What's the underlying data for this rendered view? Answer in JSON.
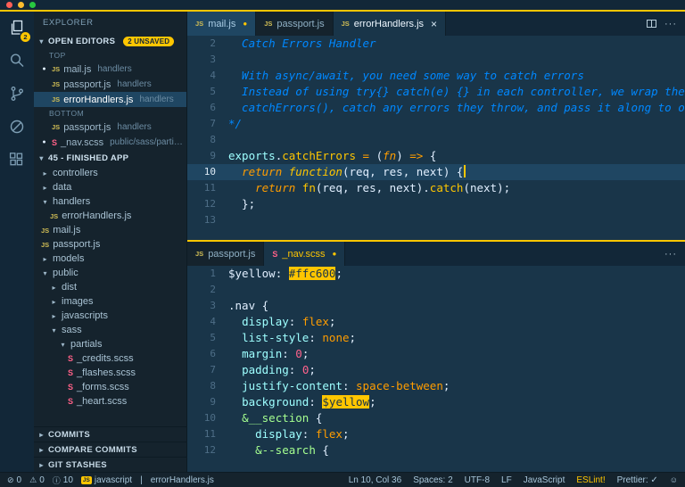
{
  "window": {
    "buttons": [
      "close",
      "minimize",
      "zoom"
    ],
    "accent_color": "#ffc600"
  },
  "activity_bar": {
    "items": [
      {
        "name": "explorer",
        "icon": "files-icon",
        "active": true,
        "badge": "2"
      },
      {
        "name": "search",
        "icon": "search-icon",
        "active": false
      },
      {
        "name": "source-control",
        "icon": "git-branch-icon",
        "active": false
      },
      {
        "name": "debug",
        "icon": "debug-icon",
        "active": false
      },
      {
        "name": "extensions",
        "icon": "extensions-icon",
        "active": false
      }
    ]
  },
  "sidebar": {
    "title": "EXPLORER",
    "open_editors": {
      "label": "OPEN EDITORS",
      "badge": "2 UNSAVED",
      "groups": [
        {
          "label": "TOP",
          "items": [
            {
              "icon": "js",
              "name": "mail.js",
              "detail": "handlers",
              "modified": true,
              "selected": false
            },
            {
              "icon": "js",
              "name": "passport.js",
              "detail": "handlers",
              "modified": false,
              "selected": false
            },
            {
              "icon": "js",
              "name": "errorHandlers.js",
              "detail": "handlers",
              "modified": false,
              "selected": true
            }
          ]
        },
        {
          "label": "BOTTOM",
          "items": [
            {
              "icon": "js",
              "name": "passport.js",
              "detail": "handlers",
              "modified": false,
              "selected": false
            },
            {
              "icon": "scss",
              "name": "_nav.scss",
              "detail": "public/sass/partials",
              "modified": true,
              "selected": false
            }
          ]
        }
      ]
    },
    "tree": {
      "label": "45 - FINISHED APP",
      "items": [
        {
          "indent": 0,
          "kind": "folder",
          "expanded": false,
          "name": "controllers"
        },
        {
          "indent": 0,
          "kind": "folder",
          "expanded": false,
          "name": "data"
        },
        {
          "indent": 0,
          "kind": "folder",
          "expanded": true,
          "name": "handlers"
        },
        {
          "indent": 1,
          "kind": "js",
          "name": "errorHandlers.js"
        },
        {
          "indent": 0,
          "kind": "js",
          "name": "mail.js"
        },
        {
          "indent": 0,
          "kind": "js",
          "name": "passport.js"
        },
        {
          "indent": 0,
          "kind": "folder",
          "expanded": false,
          "name": "models"
        },
        {
          "indent": 0,
          "kind": "folder",
          "expanded": true,
          "name": "public"
        },
        {
          "indent": 1,
          "kind": "folder",
          "expanded": false,
          "name": "dist"
        },
        {
          "indent": 1,
          "kind": "folder",
          "expanded": false,
          "name": "images"
        },
        {
          "indent": 1,
          "kind": "folder",
          "expanded": false,
          "name": "javascripts"
        },
        {
          "indent": 1,
          "kind": "folder",
          "expanded": true,
          "name": "sass"
        },
        {
          "indent": 2,
          "kind": "folder",
          "expanded": true,
          "name": "partials"
        },
        {
          "indent": 3,
          "kind": "scss",
          "name": "_credits.scss"
        },
        {
          "indent": 3,
          "kind": "scss",
          "name": "_flashes.scss"
        },
        {
          "indent": 3,
          "kind": "scss",
          "name": "_forms.scss"
        },
        {
          "indent": 3,
          "kind": "scss",
          "name": "_heart.scss"
        }
      ]
    },
    "bottom_sections": [
      "COMMITS",
      "COMPARE COMMITS",
      "GIT STASHES"
    ]
  },
  "editor_groups": [
    {
      "name": "top",
      "tabs": [
        {
          "label": "mail.js",
          "icon": "js",
          "state": "highlight",
          "modified": true,
          "close": false
        },
        {
          "label": "passport.js",
          "icon": "js",
          "state": "",
          "modified": false,
          "close": false
        },
        {
          "label": "errorHandlers.js",
          "icon": "js",
          "state": "active",
          "modified": false,
          "close": true
        }
      ],
      "actions": [
        {
          "icon": "split-editor-icon"
        },
        {
          "icon": "more-actions-icon"
        }
      ],
      "lines": [
        {
          "n": 2,
          "t": [
            [
              "cm",
              "  Catch Errors Handler"
            ]
          ]
        },
        {
          "n": 3,
          "t": []
        },
        {
          "n": 4,
          "t": [
            [
              "cm",
              "  With async/await, you need some way to catch errors"
            ]
          ]
        },
        {
          "n": 5,
          "t": [
            [
              "cm",
              "  Instead of using try{} catch(e) {} in each controller, we wrap the function in"
            ]
          ]
        },
        {
          "n": 6,
          "t": [
            [
              "cm",
              "  catchErrors(), catch any errors they throw, and pass it along to our express middleware"
            ]
          ]
        },
        {
          "n": 7,
          "t": [
            [
              "cm",
              "*/"
            ]
          ]
        },
        {
          "n": 8,
          "t": []
        },
        {
          "n": 9,
          "t": [
            [
              "bi",
              "exports"
            ],
            [
              "pl",
              "."
            ],
            [
              "fn",
              "catchErrors"
            ],
            [
              "pl",
              " "
            ],
            [
              "kw",
              "="
            ],
            [
              "pl",
              " ("
            ],
            [
              "kw",
              "fn"
            ],
            [
              "pl",
              ") "
            ],
            [
              "kw",
              "=>"
            ],
            [
              "pl",
              " {"
            ]
          ]
        },
        {
          "n": 10,
          "cur": true,
          "cursor": true,
          "t": [
            [
              "pl",
              "  "
            ],
            [
              "kw",
              "return"
            ],
            [
              "pl",
              " "
            ],
            [
              "fnk",
              "function"
            ],
            [
              "pl",
              "(req, res, next) {"
            ]
          ]
        },
        {
          "n": 11,
          "t": [
            [
              "pl",
              "    "
            ],
            [
              "kw",
              "return"
            ],
            [
              "pl",
              " "
            ],
            [
              "fn",
              "fn"
            ],
            [
              "pl",
              "(req, res, next)."
            ],
            [
              "fn",
              "catch"
            ],
            [
              "pl",
              "(next);"
            ]
          ]
        },
        {
          "n": 12,
          "t": [
            [
              "pl",
              "  };"
            ]
          ]
        },
        {
          "n": 13,
          "t": []
        }
      ]
    },
    {
      "name": "bottom",
      "tabs": [
        {
          "label": "passport.js",
          "icon": "js",
          "state": "",
          "modified": false,
          "close": false
        },
        {
          "label": "_nav.scss",
          "icon": "scss",
          "state": "active yellow",
          "modified": true,
          "close": false
        }
      ],
      "actions": [
        {
          "icon": "more-actions-icon"
        }
      ],
      "lines": [
        {
          "n": 1,
          "t": [
            [
              "pl",
              "$yellow"
            ],
            [
              "pl",
              ": "
            ],
            [
              "hly",
              "#ffc600"
            ],
            [
              "pl",
              ";"
            ]
          ]
        },
        {
          "n": 2,
          "t": []
        },
        {
          "n": 3,
          "t": [
            [
              "pl",
              ".nav"
            ],
            [
              "pl",
              " {"
            ]
          ]
        },
        {
          "n": 4,
          "t": [
            [
              "pl",
              "  "
            ],
            [
              "prop",
              "display"
            ],
            [
              "pl",
              ": "
            ],
            [
              "val",
              "flex"
            ],
            [
              "pl",
              ";"
            ]
          ]
        },
        {
          "n": 5,
          "t": [
            [
              "pl",
              "  "
            ],
            [
              "prop",
              "list-style"
            ],
            [
              "pl",
              ": "
            ],
            [
              "val",
              "none"
            ],
            [
              "pl",
              ";"
            ]
          ]
        },
        {
          "n": 6,
          "t": [
            [
              "pl",
              "  "
            ],
            [
              "prop",
              "margin"
            ],
            [
              "pl",
              ": "
            ],
            [
              "num",
              "0"
            ],
            [
              "pl",
              ";"
            ]
          ]
        },
        {
          "n": 7,
          "t": [
            [
              "pl",
              "  "
            ],
            [
              "prop",
              "padding"
            ],
            [
              "pl",
              ": "
            ],
            [
              "num",
              "0"
            ],
            [
              "pl",
              ";"
            ]
          ]
        },
        {
          "n": 8,
          "t": [
            [
              "pl",
              "  "
            ],
            [
              "prop",
              "justify-content"
            ],
            [
              "pl",
              ": "
            ],
            [
              "val",
              "space-between"
            ],
            [
              "pl",
              ";"
            ]
          ]
        },
        {
          "n": 9,
          "t": [
            [
              "pl",
              "  "
            ],
            [
              "prop",
              "background"
            ],
            [
              "pl",
              ": "
            ],
            [
              "hly",
              "$yellow"
            ],
            [
              "pl",
              ";"
            ]
          ]
        },
        {
          "n": 10,
          "t": [
            [
              "pl",
              "  "
            ],
            [
              "sel",
              "&__section"
            ],
            [
              "pl",
              " {"
            ]
          ]
        },
        {
          "n": 11,
          "t": [
            [
              "pl",
              "    "
            ],
            [
              "prop",
              "display"
            ],
            [
              "pl",
              ": "
            ],
            [
              "val",
              "flex"
            ],
            [
              "pl",
              ";"
            ]
          ]
        },
        {
          "n": 12,
          "t": [
            [
              "pl",
              "    "
            ],
            [
              "sel",
              "&--search"
            ],
            [
              "pl",
              " {"
            ]
          ]
        }
      ]
    }
  ],
  "status_bar": {
    "left": [
      {
        "name": "errors",
        "icon": "error-icon",
        "label": "0"
      },
      {
        "name": "warnings",
        "icon": "warning-icon",
        "label": "0"
      },
      {
        "name": "info",
        "icon": "info-icon",
        "label": "10"
      },
      {
        "name": "language-mode",
        "icon": "js-badge-icon",
        "label": "javascript"
      },
      {
        "name": "separator",
        "label": "|"
      },
      {
        "name": "filename",
        "label": "errorHandlers.js"
      }
    ],
    "right": [
      {
        "name": "cursor-position",
        "label": "Ln 10, Col 36"
      },
      {
        "name": "indentation",
        "label": "Spaces: 2"
      },
      {
        "name": "encoding",
        "label": "UTF-8"
      },
      {
        "name": "eol",
        "label": "LF"
      },
      {
        "name": "language",
        "label": "JavaScript"
      },
      {
        "name": "eslint",
        "label": "ESLint!",
        "accent": true
      },
      {
        "name": "prettier",
        "label": "Prettier: ✓"
      },
      {
        "name": "feedback",
        "icon": "smiley-icon",
        "label": ""
      }
    ]
  }
}
